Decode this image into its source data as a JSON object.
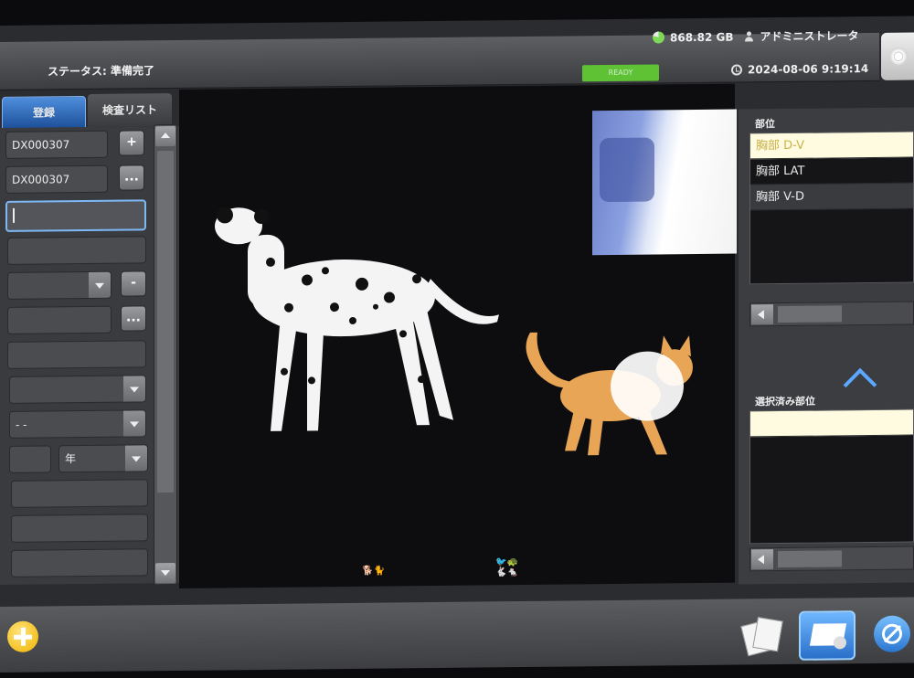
{
  "header": {
    "status_text": "ステータス: 準備完了",
    "disk_free": "868.82 GB",
    "user_name": "アドミニストレータ",
    "ready_label": "READY",
    "datetime": "2024-08-06 9:19:14"
  },
  "tabs": {
    "register": "登録",
    "exam_list": "検査リスト"
  },
  "form": {
    "patient_id": "DX000307",
    "accession_id": "DX000307",
    "input_value": "",
    "birth_placeholder": "- -",
    "age_unit": "年",
    "add_symbol": "+",
    "more_symbol": "...",
    "minus_symbol": "-"
  },
  "right_panel": {
    "body_part_label": "部位",
    "body_parts": [
      "胸部 D-V",
      "胸部 LAT",
      "胸部 V-D"
    ],
    "selected_label": "選択済み部位"
  },
  "colors": {
    "accent_blue": "#5aa8ff",
    "ready_green": "#5fc235",
    "add_yellow": "#f0b400"
  }
}
